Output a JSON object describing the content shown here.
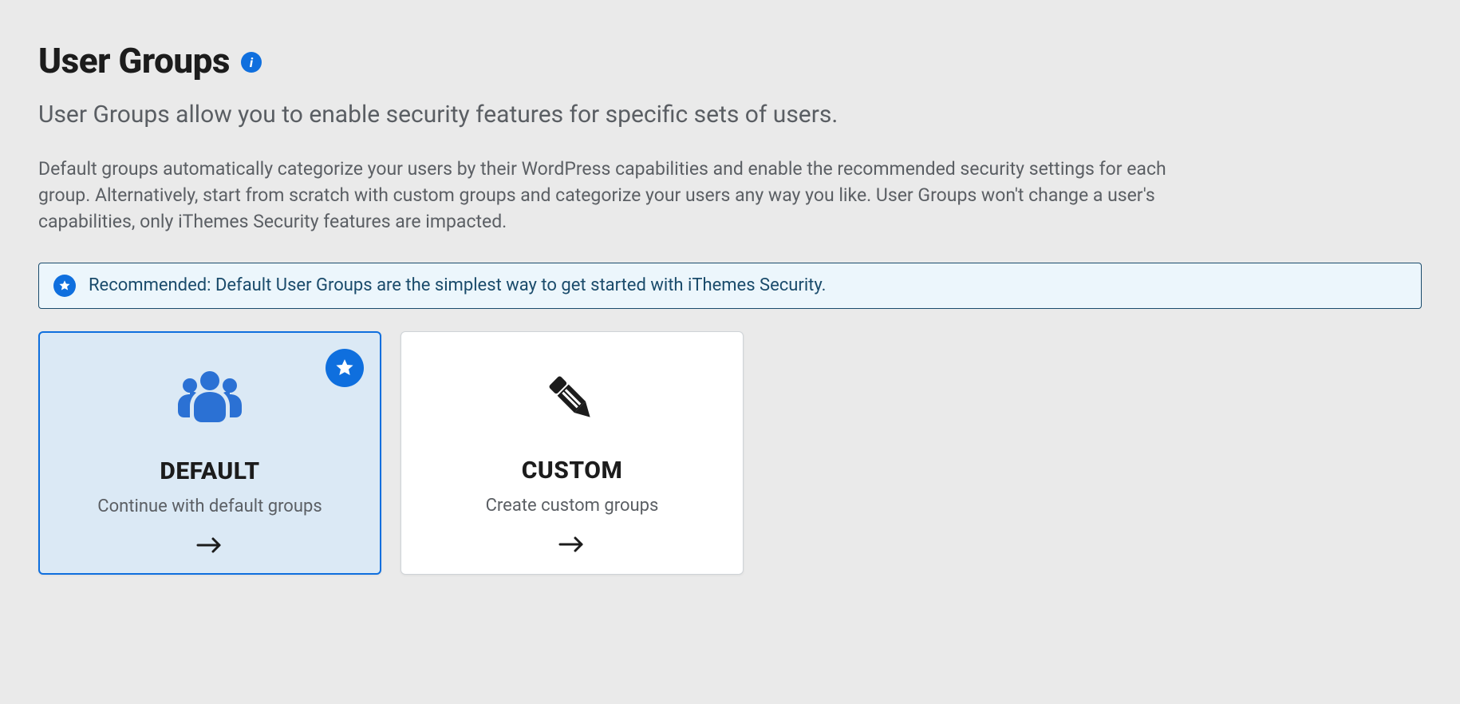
{
  "header": {
    "title": "User Groups"
  },
  "subtitle": "User Groups allow you to enable security features for specific sets of users.",
  "description": "Default groups automatically categorize your users by their WordPress capabilities and enable the recommended security settings for each group. Alternatively, start from scratch with custom groups and categorize your users any way you like. User Groups won't change a user's capabilities, only iThemes Security features are impacted.",
  "notice": {
    "text": "Recommended: Default User Groups are the simplest way to get started with iThemes Security."
  },
  "cards": {
    "default": {
      "title": "DEFAULT",
      "subtitle": "Continue with default groups"
    },
    "custom": {
      "title": "CUSTOM",
      "subtitle": "Create custom groups"
    }
  }
}
